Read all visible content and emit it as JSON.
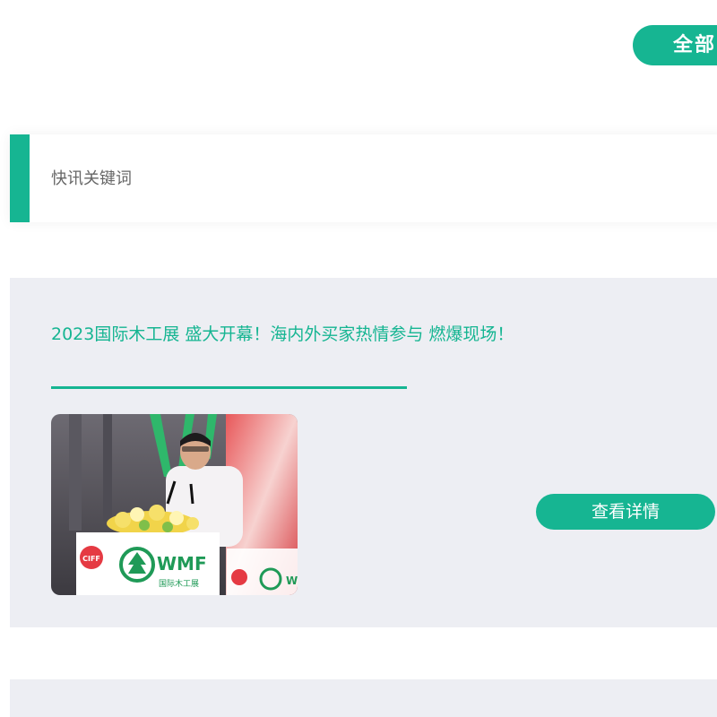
{
  "header": {
    "all_label": "全部"
  },
  "search": {
    "placeholder": "快讯关键词"
  },
  "news": [
    {
      "title": "2023国际木工展 盛大开幕！海内外买家热情参与 燃爆现场！",
      "detail_label": "查看详情",
      "image": {
        "logo_text": "WMF",
        "logo_subtext": "国际木工展",
        "badge_text": "CIFF"
      }
    }
  ],
  "colors": {
    "accent": "#16b592",
    "card_background": "#edeef3"
  }
}
